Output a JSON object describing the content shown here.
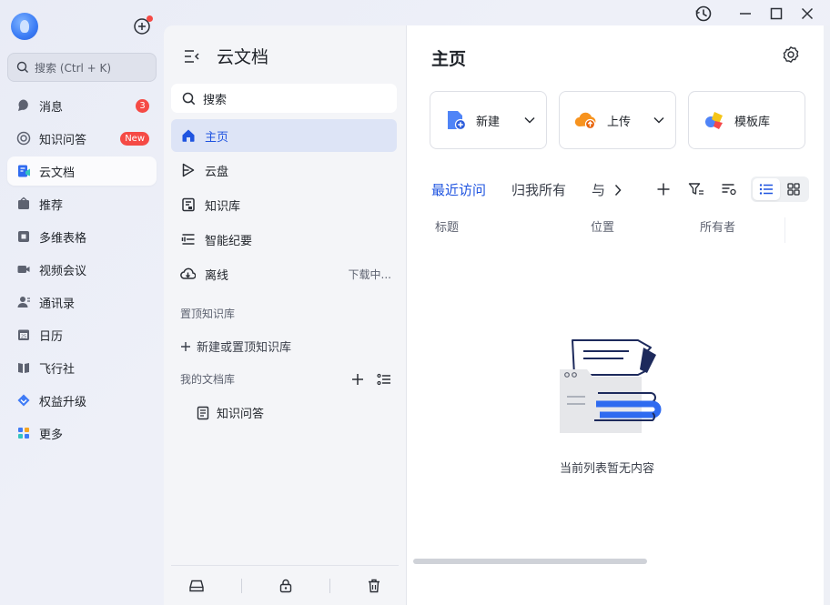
{
  "rail": {
    "search_placeholder": "搜索 (Ctrl + K)",
    "items": [
      {
        "label": "消息",
        "icon": "message-icon",
        "badge": "3"
      },
      {
        "label": "知识问答",
        "icon": "qa-icon",
        "badge": "New"
      },
      {
        "label": "云文档",
        "icon": "cloud-doc-icon",
        "active": true
      },
      {
        "label": "推荐",
        "icon": "recommend-icon"
      },
      {
        "label": "多维表格",
        "icon": "base-table-icon"
      },
      {
        "label": "视频会议",
        "icon": "video-icon"
      },
      {
        "label": "通讯录",
        "icon": "contacts-icon"
      },
      {
        "label": "日历",
        "icon": "calendar-icon"
      },
      {
        "label": "飞行社",
        "icon": "book-icon"
      },
      {
        "label": "权益升级",
        "icon": "upgrade-icon"
      },
      {
        "label": "更多",
        "icon": "more-apps-icon"
      }
    ]
  },
  "mid": {
    "title": "云文档",
    "search_label": "搜索",
    "nav": [
      {
        "label": "主页",
        "icon": "home-icon",
        "active": true
      },
      {
        "label": "云盘",
        "icon": "drive-icon"
      },
      {
        "label": "知识库",
        "icon": "wiki-icon"
      },
      {
        "label": "智能纪要",
        "icon": "minutes-icon"
      },
      {
        "label": "离线",
        "icon": "offline-icon",
        "status": "下载中..."
      }
    ],
    "pinned_label": "置顶知识库",
    "pinned_new": "新建或置顶知识库",
    "mylib_label": "我的文档库",
    "doc_item": "知识问答"
  },
  "main": {
    "title": "主页",
    "cards": [
      {
        "label": "新建",
        "icon": "new-doc-icon",
        "dropdown": true
      },
      {
        "label": "上传",
        "icon": "upload-cloud-icon",
        "dropdown": true
      },
      {
        "label": "模板库",
        "icon": "template-icon",
        "dropdown": false
      }
    ],
    "tabs": [
      "最近访问",
      "归我所有",
      "与"
    ],
    "columns": [
      "标题",
      "位置",
      "所有者"
    ],
    "empty_text": "当前列表暂无内容"
  },
  "colors": {
    "accent": "#1f54e0",
    "badge": "#f54a45",
    "active_nav_bg": "#dde4f6"
  }
}
